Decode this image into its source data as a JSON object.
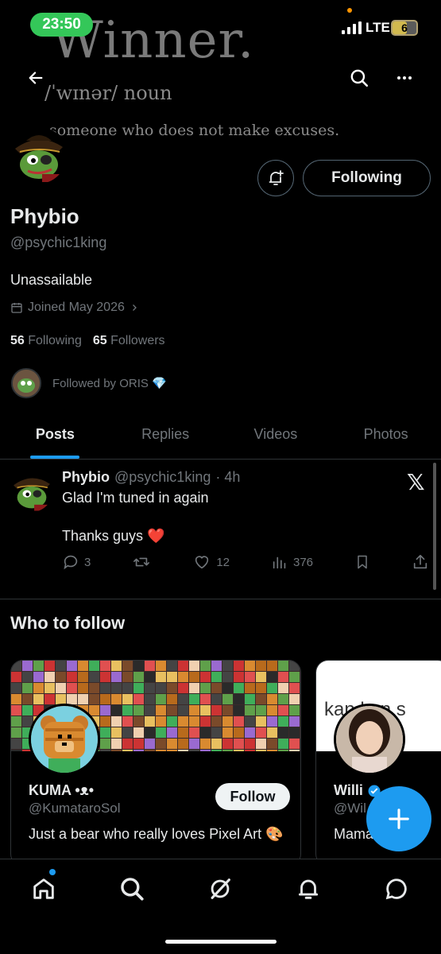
{
  "status_bar": {
    "time": "23:50",
    "network": "LTE",
    "battery": "6",
    "battery_level": 0.6
  },
  "banner": {
    "word": "Winner.",
    "phonetic": "/ˈwɪnər/ noun",
    "definition": "someone who does not make excuses."
  },
  "profile": {
    "name": "Phybio",
    "handle": "@psychic1king",
    "bio": "Unassailable",
    "joined": "Joined May 2026",
    "following_count": "56",
    "following_label": "Following",
    "followers_count": "65",
    "followers_label": "Followers",
    "followed_by": "Followed by ORIS 💎",
    "following_button": "Following"
  },
  "tabs": [
    {
      "label": "Posts",
      "active": true
    },
    {
      "label": "Replies"
    },
    {
      "label": "Videos"
    },
    {
      "label": "Photos"
    }
  ],
  "post": {
    "author": "Phybio",
    "handle": "@psychic1king",
    "time": "· 4h",
    "line1": "Glad I'm tuned in again",
    "line2": "Thanks guys ❤️",
    "replies": "3",
    "likes": "12",
    "views": "376"
  },
  "who_to_follow": {
    "title": "Who to follow",
    "cards": [
      {
        "name": "KUMA •ᴥ•",
        "handle": "@KumataroSol",
        "bio": "Just a bear who really loves Pixel Art 🎨",
        "button": "Follow"
      },
      {
        "name": "Willi",
        "handle": "@Wil",
        "bio": "Mama",
        "banner_text": "kan   kan s"
      }
    ]
  },
  "colors": {
    "accent": "#1d9bf0",
    "status_green": "#34c759",
    "background": "#000000"
  }
}
